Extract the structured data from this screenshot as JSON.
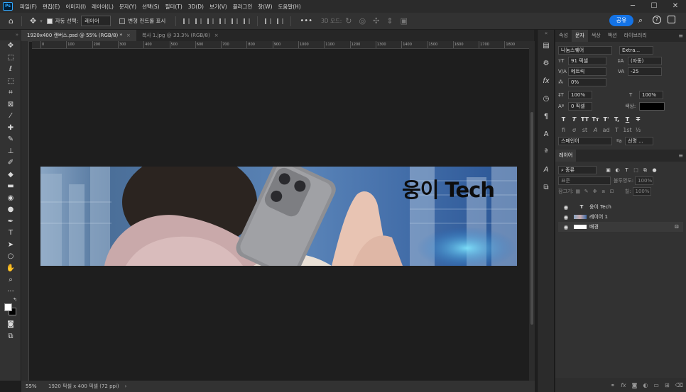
{
  "app": {
    "logo": "Ps"
  },
  "menu": [
    "파일(F)",
    "편집(E)",
    "이미지(I)",
    "레이어(L)",
    "문자(Y)",
    "선택(S)",
    "필터(T)",
    "3D(D)",
    "보기(V)",
    "플러그인",
    "창(W)",
    "도움말(H)"
  ],
  "window_controls": {
    "minimize": "─",
    "maximize": "☐",
    "close": "✕"
  },
  "options": {
    "auto_select_label": "자동 선택:",
    "auto_select_value": "레이어",
    "transform_label": "변형 컨트롤 표시",
    "more": "•••",
    "mode_3d": "3D 모드:",
    "share": "공유"
  },
  "tabs": [
    {
      "label": "1920x400 캔버스.psd @ 55% (RGB/8) *",
      "active": true
    },
    {
      "label": "복사 1.jpg @ 33.3% (RGB/8)",
      "active": false
    }
  ],
  "ruler": {
    "ticks": [
      "0",
      "100",
      "200",
      "300",
      "400",
      "500",
      "600",
      "700",
      "800",
      "900",
      "1000",
      "1100",
      "1200",
      "1300",
      "1400",
      "1500",
      "1600",
      "1700",
      "1800",
      "1900"
    ]
  },
  "canvas": {
    "text": "웅이 Tech"
  },
  "status": {
    "zoom": "55%",
    "info": "1920 픽셀 x 400 픽셀 (72 ppi)"
  },
  "panels": {
    "tabs": [
      "속성",
      "문자",
      "색상",
      "액션",
      "라이브러리"
    ],
    "active_tab": "문자",
    "character": {
      "font_family": "나눔스퀘어",
      "font_style": "Extra...",
      "size": "91 픽셀",
      "leading": "(자동)",
      "kerning": "메트릭",
      "tracking": "-25",
      "tsume": "0%",
      "vscale": "100%",
      "hscale": "100%",
      "baseline": "0 픽셀",
      "color_label": "색상:",
      "color": "#000000",
      "language": "스페인어",
      "antialias_label": "ªa",
      "antialias": "선명 ..."
    },
    "style_buttons": [
      "T",
      "T",
      "TT",
      "Tт",
      "T'",
      "T,",
      "T",
      "T"
    ],
    "opentype_buttons": [
      "fi",
      "ơ",
      "st",
      "A",
      "ad",
      "T",
      "1st",
      "½"
    ]
  },
  "layers": {
    "tab": "레이어",
    "filter": "종류",
    "blend": "표준",
    "opacity_label": "불투명도:",
    "opacity": "100%",
    "lock_label": "잠그기:",
    "fill_label": "칠:",
    "fill": "100%",
    "items": [
      {
        "name": "웅이 Tech",
        "type": "text"
      },
      {
        "name": "레이어 1",
        "type": "image"
      },
      {
        "name": "배경",
        "type": "background",
        "locked": true
      }
    ]
  }
}
